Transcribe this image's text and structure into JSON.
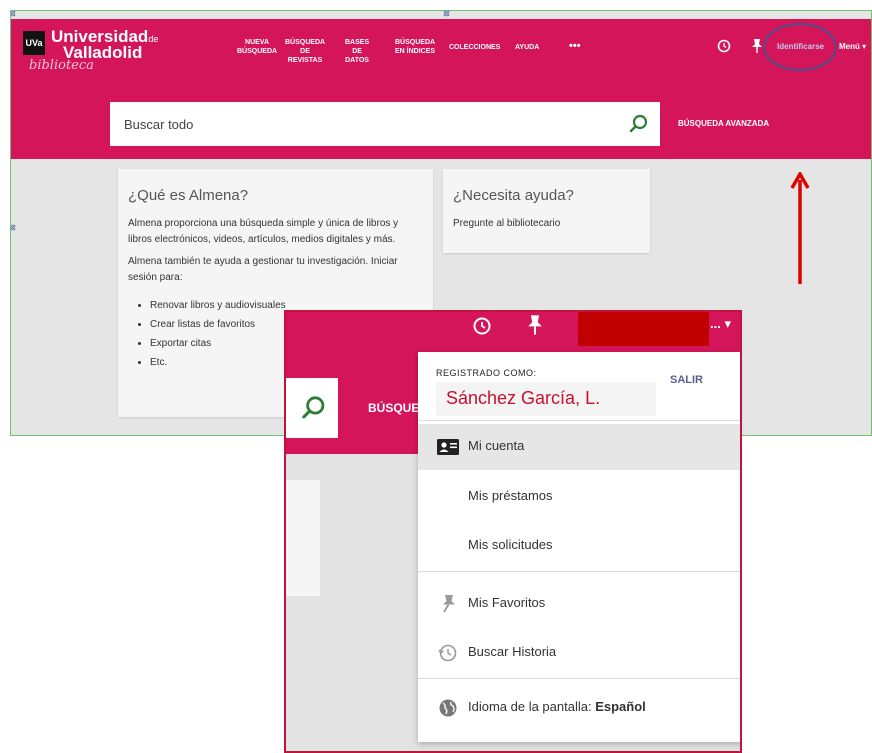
{
  "header": {
    "logo": {
      "badge": "UVa",
      "line1": "Universidad",
      "line1_suffix": "de",
      "line2": "Valladolid",
      "line3": "biblioteca"
    },
    "nav": [
      {
        "label": "NUEVA\nBÚSQUEDA"
      },
      {
        "label": "BÚSQUEDA\nDE REVISTAS"
      },
      {
        "label": "BASES DE\nDATOS"
      },
      {
        "label": "BÚSQUEDA\nEN ÍNDICES"
      },
      {
        "label": "COLECCIONES"
      },
      {
        "label": "AYUDA"
      }
    ],
    "more": "•••",
    "identify_label": "Identificarse",
    "menu_label": "Menú ▾"
  },
  "search": {
    "placeholder": "Buscar todo",
    "advanced_label": "BÚSQUEDA AVANZADA"
  },
  "cards": {
    "what": {
      "title": "¿Qué es Almena?",
      "p1": "Almena proporciona una búsqueda simple y única de libros y libros electrónicos, videos, artículos, medios digitales y más.",
      "p2": "Almena también te ayuda a gestionar tu investigación. Iniciar sesión para:",
      "items": [
        "Renovar libros y audiovisuales",
        "Crear listas de favoritos",
        "Exportar citas",
        "Etc."
      ]
    },
    "help": {
      "title": "¿Necesita ayuda?",
      "text": "Pregunte al bibliotecario"
    }
  },
  "zoom": {
    "more": "... ▾",
    "search_label": "BÚSQUE",
    "dropdown": {
      "registered_label": "REGISTRADO COMO:",
      "user_name": "Sánchez García, L.",
      "logout": "SALIR",
      "items": [
        {
          "label": "Mi cuenta",
          "icon": "id-card-icon",
          "active": true
        },
        {
          "label": "Mis préstamos"
        },
        {
          "label": "Mis solicitudes"
        },
        {
          "label": "Mis Favoritos",
          "icon": "pin-icon"
        },
        {
          "label": "Buscar Historia",
          "icon": "history-icon"
        }
      ],
      "language_label": "Idioma de la pantalla:",
      "language_value": "Español"
    }
  },
  "colors": {
    "brand": "#d5155a",
    "highlight_ring": "#4a4e8a",
    "annotation_red": "#e00000",
    "search_icon": "#2e7d32"
  }
}
